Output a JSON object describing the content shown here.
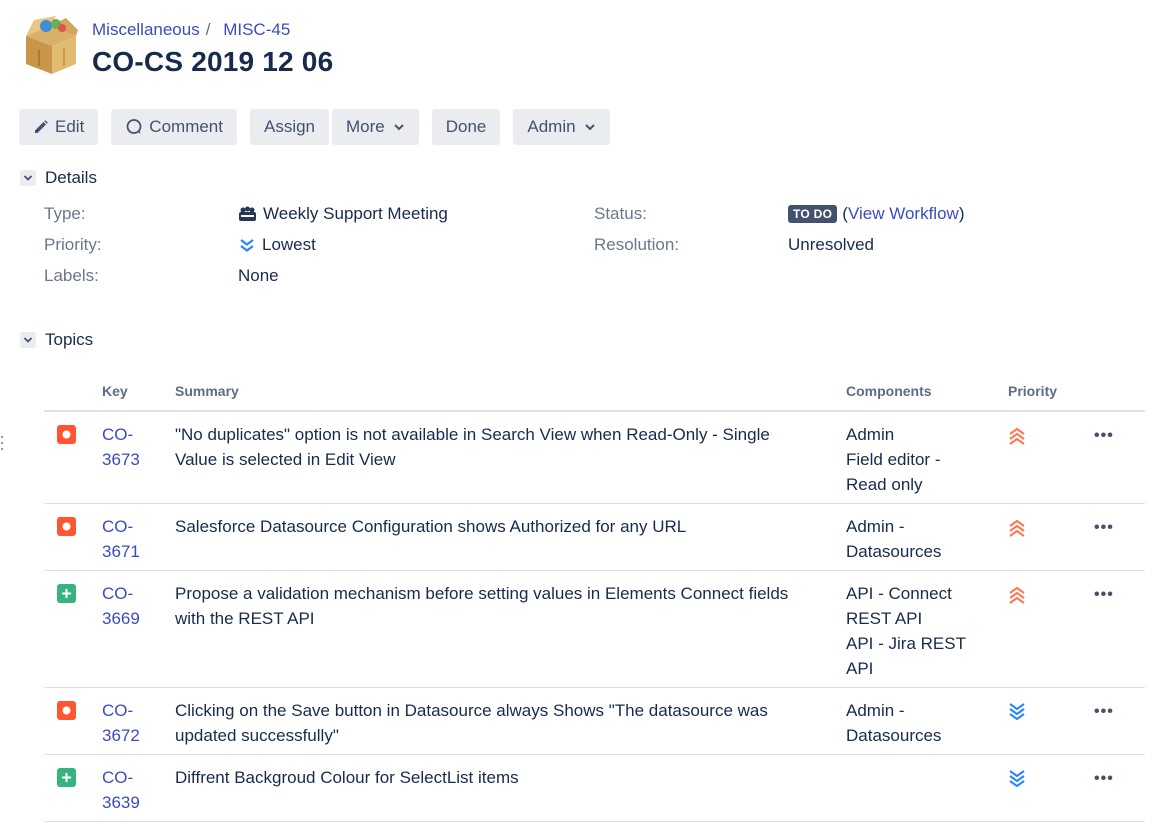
{
  "breadcrumbs": {
    "project": "Miscellaneous",
    "issue_key": "MISC-45"
  },
  "issue": {
    "title": "CO-CS 2019 12 06"
  },
  "toolbar": {
    "edit": "Edit",
    "comment": "Comment",
    "assign": "Assign",
    "more": "More",
    "done": "Done",
    "admin": "Admin"
  },
  "details": {
    "heading": "Details",
    "type_label": "Type:",
    "type_value": "Weekly Support Meeting",
    "priority_label": "Priority:",
    "priority_value": "Lowest",
    "labels_label": "Labels:",
    "labels_value": "None",
    "status_label": "Status:",
    "status_value": "TO DO",
    "status_link": "View Workflow",
    "resolution_label": "Resolution:",
    "resolution_value": "Unresolved"
  },
  "topics": {
    "heading": "Topics",
    "columns": {
      "key": "Key",
      "summary": "Summary",
      "components": "Components",
      "priority": "Priority"
    },
    "rows": [
      {
        "type": "bug",
        "key_l1": "CO-",
        "key_l2": "3673",
        "summary": "\"No duplicates\" option is not available in Search View when Read-Only - Single Value is selected in Edit View",
        "components": [
          "Admin",
          "Field editor -",
          "Read only"
        ],
        "priority": "highest",
        "more": "•••"
      },
      {
        "type": "bug",
        "key_l1": "CO-",
        "key_l2": "3671",
        "summary": "Salesforce Datasource Configuration shows Authorized for any URL",
        "components": [
          "Admin -",
          "Datasources"
        ],
        "priority": "highest",
        "more": "•••"
      },
      {
        "type": "new-feature",
        "key_l1": "CO-",
        "key_l2": "3669",
        "summary": "Propose a validation mechanism before setting values in Elements Connect fields with the REST API",
        "components": [
          "API - Connect",
          "REST API",
          "API - Jira REST",
          "API"
        ],
        "priority": "highest",
        "more": "•••"
      },
      {
        "type": "bug",
        "key_l1": "CO-",
        "key_l2": "3672",
        "summary": "Clicking on the Save button in Datasource always Shows \"The datasource was updated successfully\"",
        "components": [
          "Admin -",
          "Datasources"
        ],
        "priority": "lowest",
        "more": "•••"
      },
      {
        "type": "new-feature",
        "key_l1": "CO-",
        "key_l2": "3639",
        "summary": "Diffrent Backgroud Colour for SelectList items",
        "components": [],
        "priority": "lowest",
        "more": "•••"
      }
    ]
  },
  "colors": {
    "bug": "#ff5630",
    "new_feature": "#36b37e",
    "highest": "#ff7452",
    "lowest": "#2684ff",
    "link": "#3b4cc0"
  }
}
